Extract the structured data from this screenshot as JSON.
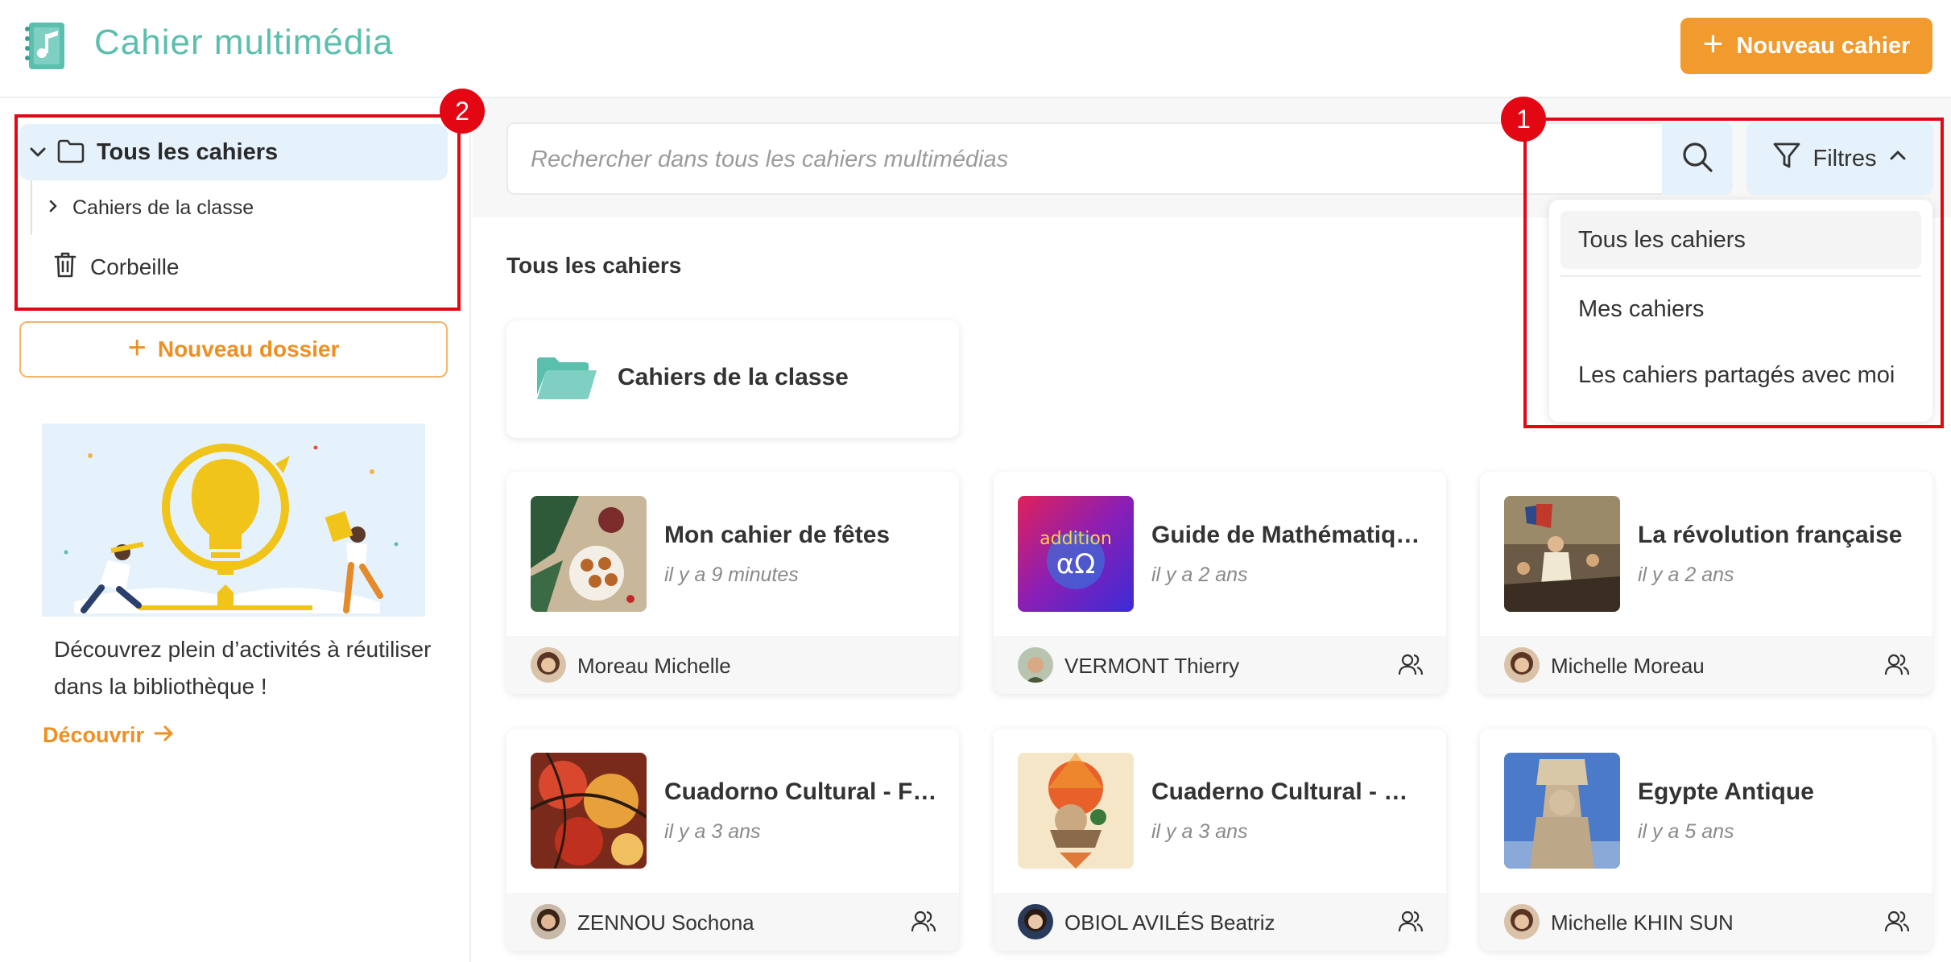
{
  "header": {
    "app_title": "Cahier multimédia",
    "new_notebook_label": "Nouveau cahier",
    "accent_color": "#f19a2e",
    "brand_color": "#5bbfae"
  },
  "sidebar": {
    "root_label": "Tous les cahiers",
    "child_label": "Cahiers de la classe",
    "trash_label": "Corbeille",
    "new_folder_label": "Nouveau dossier",
    "promo_text": "Découvrez plein d’activités à réutiliser dans la bibliothèque !",
    "discover_label": "Découvrir"
  },
  "annotations": {
    "badge_1": "1",
    "badge_2": "2"
  },
  "search": {
    "placeholder": "Rechercher dans tous les cahiers multimédias",
    "filters_label": "Filtres",
    "filter_options": [
      "Tous les cahiers",
      "Mes cahiers",
      "Les cahiers partagés avec moi"
    ],
    "selected_filter": "Tous les cahiers"
  },
  "main": {
    "section_title": "Tous les cahiers",
    "folder_card_label": "Cahiers de la classe",
    "notebooks": [
      {
        "title": "Mon cahier de fêtes",
        "time": "il y a 9 minutes",
        "author": "Moreau Michelle",
        "shared": false
      },
      {
        "title": "Guide de Mathématiques pour tous",
        "time": "il y a 2 ans",
        "author": "VERMONT Thierry",
        "shared": true
      },
      {
        "title": "La révolution française",
        "time": "il y a 2 ans",
        "author": "Michelle Moreau",
        "shared": true
      },
      {
        "title": "Cuadorno Cultural - Francia",
        "time": "il y a 3 ans",
        "author": "ZENNOU Sochona",
        "shared": true
      },
      {
        "title": "Cuaderno Cultural - Mexico",
        "time": "il y a 3 ans",
        "author": "OBIOL AVILÉS Beatriz",
        "shared": true
      },
      {
        "title": "Egypte Antique",
        "time": "il y a 5 ans",
        "author": "Michelle KHIN SUN",
        "shared": true
      }
    ]
  }
}
